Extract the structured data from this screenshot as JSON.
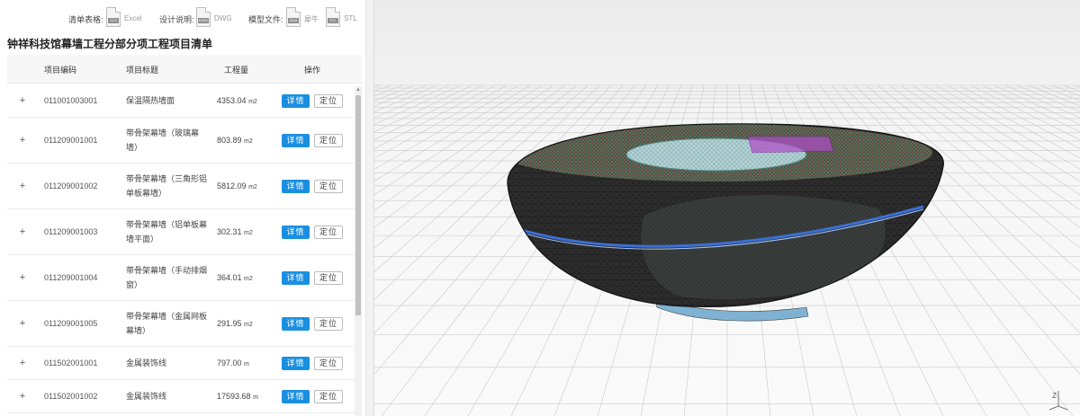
{
  "files": {
    "list_label": "清单表格:",
    "list_type": "Excel",
    "list_tag": "XLS",
    "design_label": "设计说明:",
    "design_type": "DWG",
    "design_tag": "DWG",
    "model_label": "模型文件:",
    "model_type_1": "犀牛",
    "model_tag_1": "3DM",
    "model_type_2": "STL",
    "model_tag_2": "STL"
  },
  "page_title": "钟祥科技馆幕墙工程分部分项工程项目清单",
  "table": {
    "headers": {
      "code": "项目编码",
      "title": "项目标题",
      "quantity": "工程量",
      "action": "操作"
    },
    "detail_label": "详情",
    "locate_label": "定位",
    "expand_symbol": "+",
    "rows": [
      {
        "code": "011001003001",
        "title": "保温隔热墙面",
        "qty": "4353.04",
        "unit": "m2"
      },
      {
        "code": "011209001001",
        "title": "带骨架幕墙（玻璃幕墙）",
        "qty": "803.89",
        "unit": "m2"
      },
      {
        "code": "011209001002",
        "title": "带骨架幕墙（三角形铝单板幕墙）",
        "qty": "5812.09",
        "unit": "m2"
      },
      {
        "code": "011209001003",
        "title": "带骨架幕墙（铝单板幕墙平面）",
        "qty": "302.31",
        "unit": "m2"
      },
      {
        "code": "011209001004",
        "title": "带骨架幕墙（手动排烟窗）",
        "qty": "364.01",
        "unit": "m2"
      },
      {
        "code": "011209001005",
        "title": "带骨架幕墙（金属网板幕墙）",
        "qty": "291.95",
        "unit": "m2"
      },
      {
        "code": "011502001001",
        "title": "金属装饰线",
        "qty": "797.00",
        "unit": "m"
      },
      {
        "code": "011502001002",
        "title": "金属装饰线",
        "qty": "17593.68",
        "unit": "m"
      }
    ]
  },
  "viewer": {
    "axis_label": "Z",
    "colors": {
      "accent": "#1a8fe0",
      "grid": "#bfbfbf",
      "mesh": "#111111",
      "band": "#3b6fd6"
    }
  }
}
